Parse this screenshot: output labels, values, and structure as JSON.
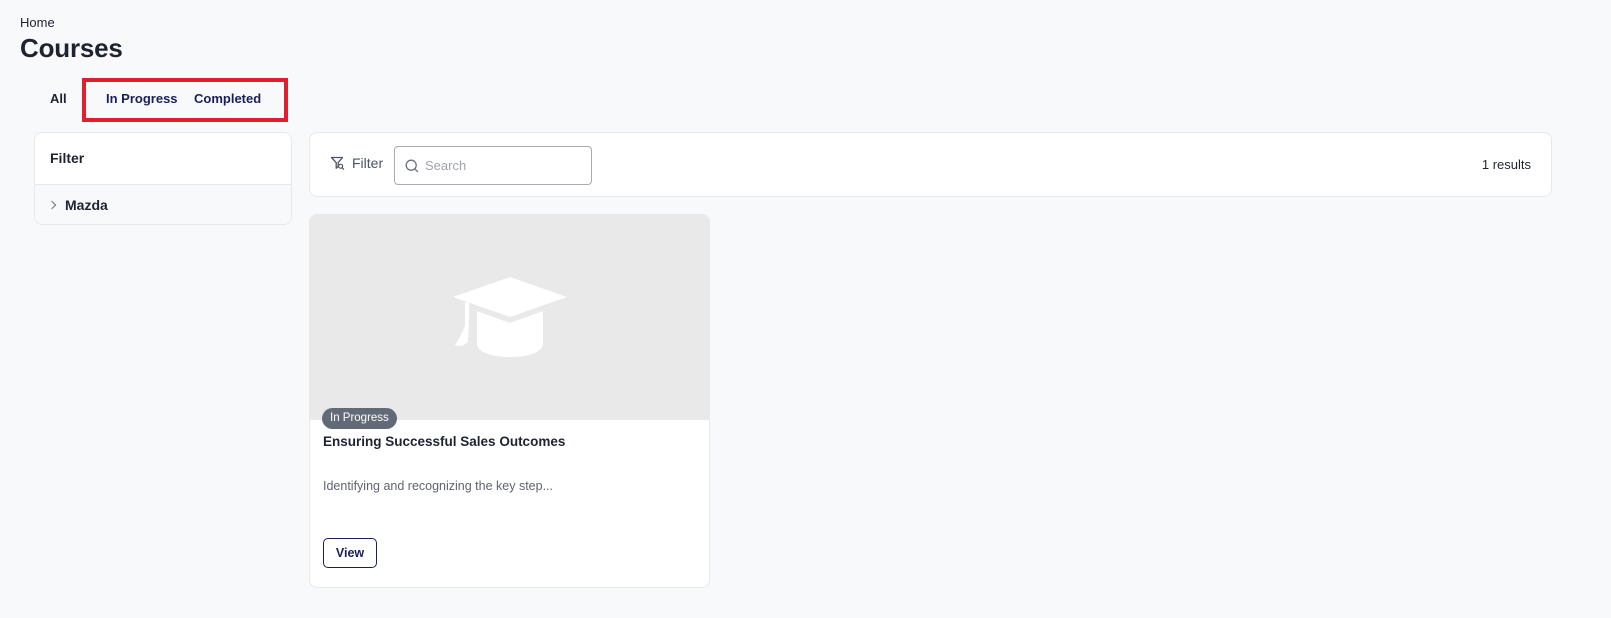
{
  "breadcrumb": {
    "home": "Home"
  },
  "page": {
    "title": "Courses"
  },
  "tabs": [
    {
      "label": "All"
    },
    {
      "label": "In Progress"
    },
    {
      "label": "Completed"
    }
  ],
  "filter_panel": {
    "title": "Filter",
    "groups": [
      {
        "label": "Mazda"
      }
    ]
  },
  "toolbar": {
    "filter_label": "Filter",
    "search_placeholder": "Search",
    "results": "1 results"
  },
  "courses": [
    {
      "status": "In Progress",
      "title": "Ensuring Successful Sales Outcomes",
      "description": "Identifying and recognizing the key step...",
      "action_label": "View",
      "thumbnail_icon": "graduation-cap-icon"
    }
  ],
  "colors": {
    "accent": "#1a1f5c",
    "highlight": "#e0202e",
    "badge": "#626a78",
    "background": "#f8f9fa"
  }
}
